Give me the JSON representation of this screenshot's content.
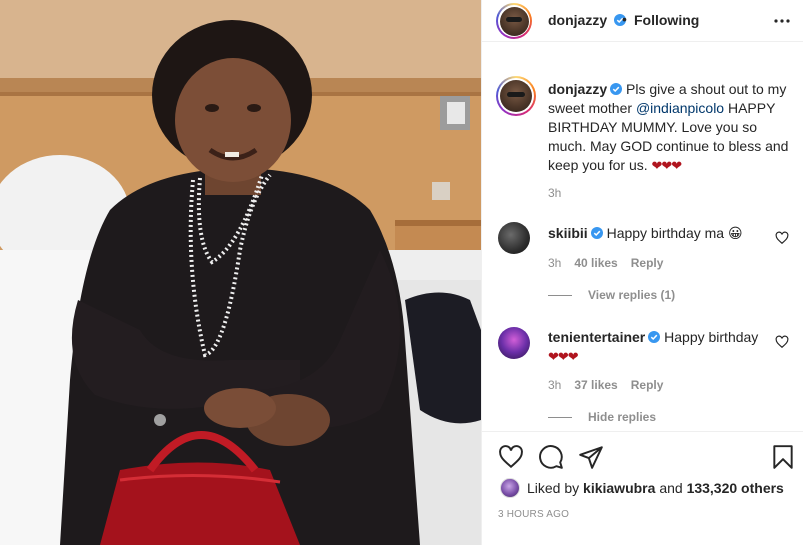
{
  "post": {
    "username": "donjazzy",
    "separator": "•",
    "follow_status": "Following",
    "caption_text_1": "Pls give a shout out to my sweet mother ",
    "caption_mention": "@indianpicolo",
    "caption_text_2": " HAPPY BIRTHDAY MUMMY. Love you so much. May GOD continue to bless and keep you for us. ",
    "caption_hearts": "❤❤❤",
    "caption_time": "3h",
    "time_ago": "3 HOURS AGO"
  },
  "comments": [
    {
      "username": "skiibii",
      "text": "Happy birthday ma",
      "emoji": "😀",
      "time": "3h",
      "likes": "40 likes",
      "reply_label": "Reply",
      "replies_label": "View replies (1)"
    },
    {
      "username": "tenientertainer",
      "text": "Happy birthday",
      "emoji": "❤❤❤",
      "time": "3h",
      "likes": "37 likes",
      "reply_label": "Reply",
      "replies_label": "Hide replies"
    }
  ],
  "likes": {
    "prefix": "Liked by",
    "user": "kikiawubra",
    "joiner": "and",
    "others": "133,320 others"
  },
  "colors": {
    "verified": "#3897f0",
    "text": "#262626",
    "muted": "#8e8e8e",
    "mention": "#00376b",
    "heart": "#b0151f"
  },
  "icons": {
    "header_more": "more-horizontal-icon",
    "like": "heart-outline-icon",
    "comment": "comment-bubble-icon",
    "share": "paper-plane-icon",
    "save": "bookmark-icon",
    "comment_like": "small-heart-icon",
    "verified": "verified-badge-icon"
  }
}
